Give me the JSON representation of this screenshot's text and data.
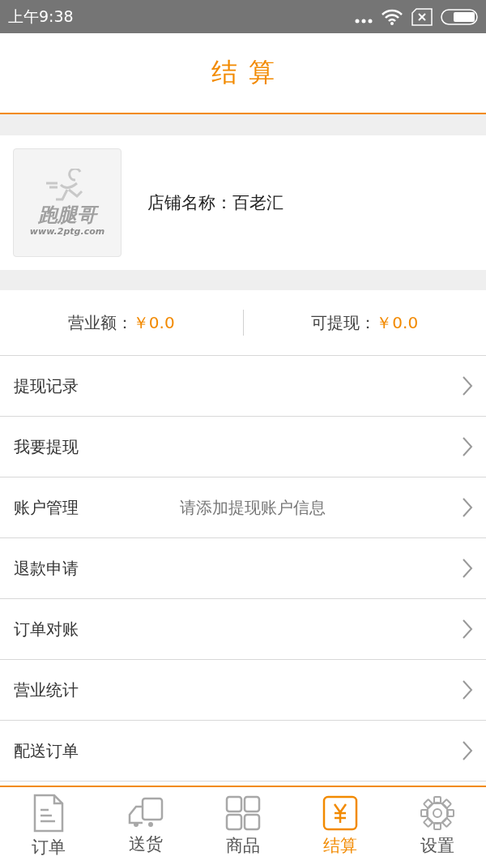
{
  "status_bar": {
    "time": "上午9:38"
  },
  "header": {
    "title": "结算"
  },
  "store": {
    "logo": {
      "name": "跑腿哥",
      "site": "www.2ptg.com"
    },
    "label": "店铺名称：",
    "name": "百老汇"
  },
  "summary": [
    {
      "label": "营业额：",
      "value": "￥0.0"
    },
    {
      "label": "可提现：",
      "value": "￥0.0"
    }
  ],
  "menu": [
    {
      "label": "提现记录"
    },
    {
      "label": "我要提现"
    },
    {
      "label": "账户管理",
      "hint": "请添加提现账户信息"
    },
    {
      "label": "退款申请"
    },
    {
      "label": "订单对账"
    },
    {
      "label": "营业统计"
    },
    {
      "label": "配送订单"
    }
  ],
  "tabs": [
    {
      "kind": "document",
      "label": "订单",
      "selected": false
    },
    {
      "kind": "truck",
      "label": "送货",
      "selected": false
    },
    {
      "kind": "grid",
      "label": "商品",
      "selected": false
    },
    {
      "kind": "yen",
      "label": "结算",
      "selected": true
    },
    {
      "kind": "gear",
      "label": "设置",
      "selected": false
    }
  ]
}
